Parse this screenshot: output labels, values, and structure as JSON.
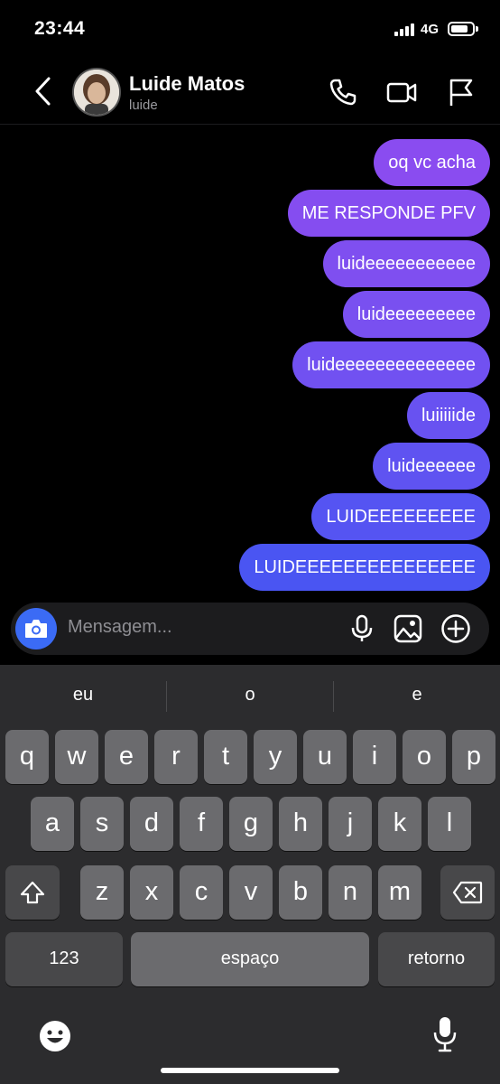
{
  "status_bar": {
    "time": "23:44",
    "network": "4G"
  },
  "header": {
    "name": "Luide Matos",
    "username": "luide",
    "icons": [
      "back-icon",
      "phone-icon",
      "video-icon",
      "flag-icon"
    ]
  },
  "messages": [
    {
      "text": "oq vc acha"
    },
    {
      "text": "ME RESPONDE PFV"
    },
    {
      "text": "luideeeeeeeeeee"
    },
    {
      "text": "luideeeeeeeee"
    },
    {
      "text": "luideeeeeeeeeeeeee"
    },
    {
      "text": "luiiiiide"
    },
    {
      "text": "luideeeeee"
    },
    {
      "text": "LUIDEEEEEEEEE"
    },
    {
      "text": "LUIDEEEEEEEEEEEEEEE"
    }
  ],
  "composer": {
    "placeholder": "Mensagem...",
    "icons": [
      "camera-icon",
      "microphone-icon",
      "gallery-icon",
      "plus-icon"
    ]
  },
  "keyboard": {
    "suggestions": [
      "eu",
      "o",
      "e"
    ],
    "row1": [
      "q",
      "w",
      "e",
      "r",
      "t",
      "y",
      "u",
      "i",
      "o",
      "p"
    ],
    "row2": [
      "a",
      "s",
      "d",
      "f",
      "g",
      "h",
      "j",
      "k",
      "l"
    ],
    "row3": [
      "z",
      "x",
      "c",
      "v",
      "b",
      "n",
      "m"
    ],
    "numbers_key": "123",
    "space_key": "espaço",
    "return_key": "retorno"
  },
  "colors": {
    "bubble_top": "#8a4cf0",
    "bubble_bottom": "#4a55f2",
    "camera_button": "#3b6bf5"
  }
}
